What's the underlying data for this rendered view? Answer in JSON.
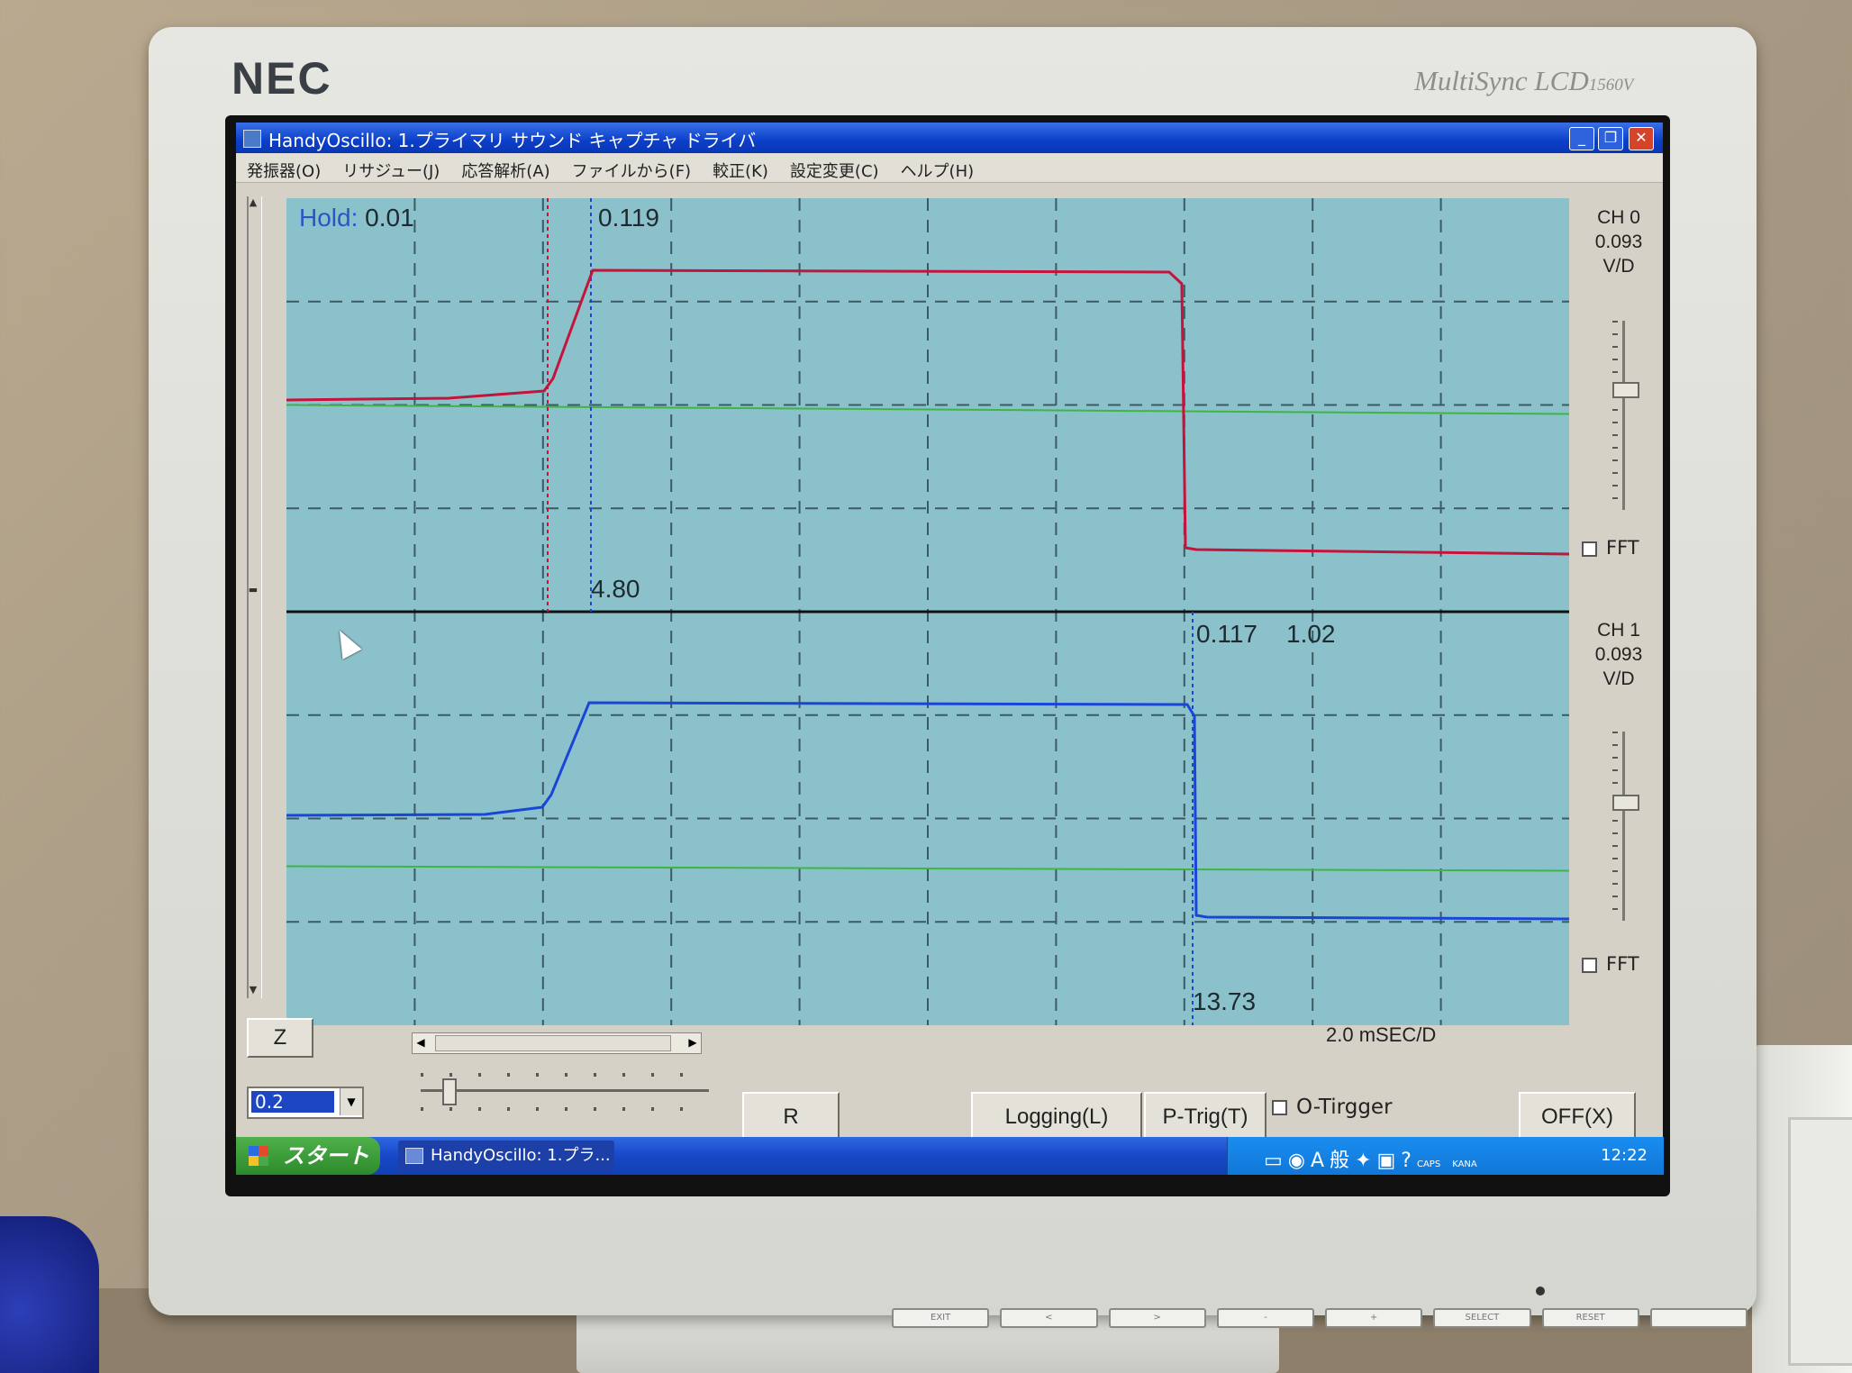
{
  "monitor": {
    "brand": "NEC",
    "model": "MultiSync LCD",
    "model_suffix": "1560V",
    "front_buttons": [
      "EXIT",
      "<",
      ">",
      "-",
      "+",
      "SELECT",
      "RESET",
      ""
    ]
  },
  "window": {
    "title": "HandyOscillo:  1.プライマリ サウンド キャプチャ ドライバ",
    "controls": {
      "minimize": "_",
      "maximize": "❐",
      "close": "✕"
    }
  },
  "menu": [
    "発振器(O)",
    "リサジュー(J)",
    "応答解析(A)",
    "ファイルから(F)",
    "較正(K)",
    "設定変更(C)",
    "ヘルプ(H)"
  ],
  "scope": {
    "hold_label": "Hold:",
    "hold_value": "0.01",
    "ch0_cursor_top": "0.119",
    "ch0_cursor_bottom": "4.80",
    "ch1_cursor_top_a": "0.117",
    "ch1_cursor_top_b": "1.02",
    "ch1_cursor_bottom": "13.73",
    "time_div": "2.0  mSEC/D",
    "colors": {
      "background": "#8bc1cb",
      "ch0_trace": "#c4143c",
      "ch1_trace": "#1a46d8",
      "baseline": "#3fb544",
      "grid": "#3d5a62"
    }
  },
  "channels": [
    {
      "name": "CH 0",
      "scale": "0.093",
      "unit": "V/D",
      "fft_label": "FFT"
    },
    {
      "name": "CH 1",
      "scale": "0.093",
      "unit": "V/D",
      "fft_label": "FFT"
    }
  ],
  "controls": {
    "z_button": "Z",
    "combo_value": "0.2",
    "r_button": "R",
    "logging_button": "Logging(L)",
    "ptrig_button": "P-Trig(T)",
    "otrig_label": "O-Tirgger",
    "off_button": "OFF(X)"
  },
  "taskbar": {
    "start": "スタート",
    "task": "HandyOscillo:  1.プラ...",
    "tray_icons": "A般",
    "caps": "CAPS",
    "kana": "KANA",
    "clock": "12:22"
  }
}
